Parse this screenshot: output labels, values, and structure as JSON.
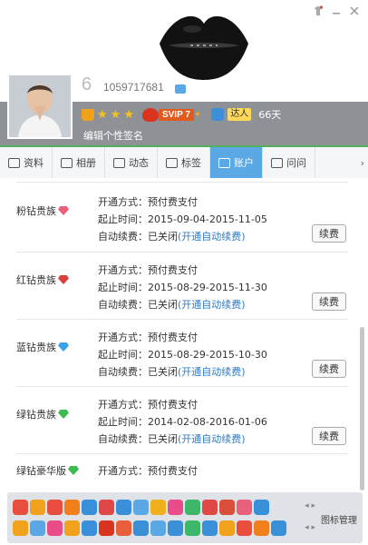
{
  "profile": {
    "level": "6",
    "qq_number": "1059717681",
    "svip_label": "SVIP 7",
    "daren_label": "达人",
    "days": "66天",
    "signature": "编辑个性签名",
    "stars": 3
  },
  "tabs": [
    {
      "label": "资料",
      "icon": "profile-card-icon"
    },
    {
      "label": "相册",
      "icon": "photo-album-icon"
    },
    {
      "label": "动态",
      "icon": "feed-icon"
    },
    {
      "label": "标签",
      "icon": "bookmark-icon"
    },
    {
      "label": "账户",
      "icon": "wallet-icon",
      "active": true
    },
    {
      "label": "问问",
      "icon": "question-icon"
    }
  ],
  "entries": [
    {
      "name": "粉钻贵族",
      "diamond_color": "#e8607a",
      "mode_label": "开通方式：",
      "mode_value": "预付费支付",
      "period_label": "起止时间：",
      "period_value": "2015-09-04-2015-11-05",
      "renew_label": "自动续费：",
      "renew_state": "已关闭",
      "renew_link": "(开通自动续费)",
      "button": "续费"
    },
    {
      "name": "红钻贵族",
      "diamond_color": "#d9403a",
      "mode_label": "开通方式：",
      "mode_value": "预付费支付",
      "period_label": "起止时间：",
      "period_value": "2015-08-29-2015-11-30",
      "renew_label": "自动续费：",
      "renew_state": "已关闭",
      "renew_link": "(开通自动续费)",
      "button": "续费"
    },
    {
      "name": "蓝钻贵族",
      "diamond_color": "#3aa0e8",
      "mode_label": "开通方式：",
      "mode_value": "预付费支付",
      "period_label": "起止时间：",
      "period_value": "2015-08-29-2015-10-30",
      "renew_label": "自动续费：",
      "renew_state": "已关闭",
      "renew_link": "(开通自动续费)",
      "button": "续费"
    },
    {
      "name": "绿钻贵族",
      "diamond_color": "#3dbb4f",
      "mode_label": "开通方式：",
      "mode_value": "预付费支付",
      "period_label": "起止时间：",
      "period_value": "2014-02-08-2016-01-06",
      "renew_label": "自动续费：",
      "renew_state": "已关闭",
      "renew_link": "(开通自动续费)",
      "button": "续费"
    }
  ],
  "partial_entry": {
    "name": "绿钻豪华版",
    "mode_label": "开通方式：",
    "mode_value": "预付费支付"
  },
  "emoji_bar": {
    "manage_label": "图标管理",
    "row1_colors": [
      "#e84d3d",
      "#f0a21c",
      "#e84d3d",
      "#f07f1c",
      "#3a8fd9",
      "#e04848",
      "#3a8fd9",
      "#5aa9e6",
      "#f0b01c",
      "#e84d8a",
      "#3db86b",
      "#e04848",
      "#d94f3a",
      "#e8607a",
      "#3a8fd9"
    ],
    "row2_colors": [
      "#f0a21c",
      "#5aa9e6",
      "#e84d8a",
      "#f0a21c",
      "#3a8fd9",
      "#d9341f",
      "#e85f3a",
      "#3a8fd9",
      "#5aa9e6",
      "#3a8fd9",
      "#3db86b",
      "#3a8fd9",
      "#f0a21c",
      "#e84d3d",
      "#f07f1c",
      "#3a8fd9"
    ]
  },
  "colors": {
    "accent_tab": "#5aa8e4",
    "link": "#2a7bc8",
    "band": "#8e9297"
  }
}
